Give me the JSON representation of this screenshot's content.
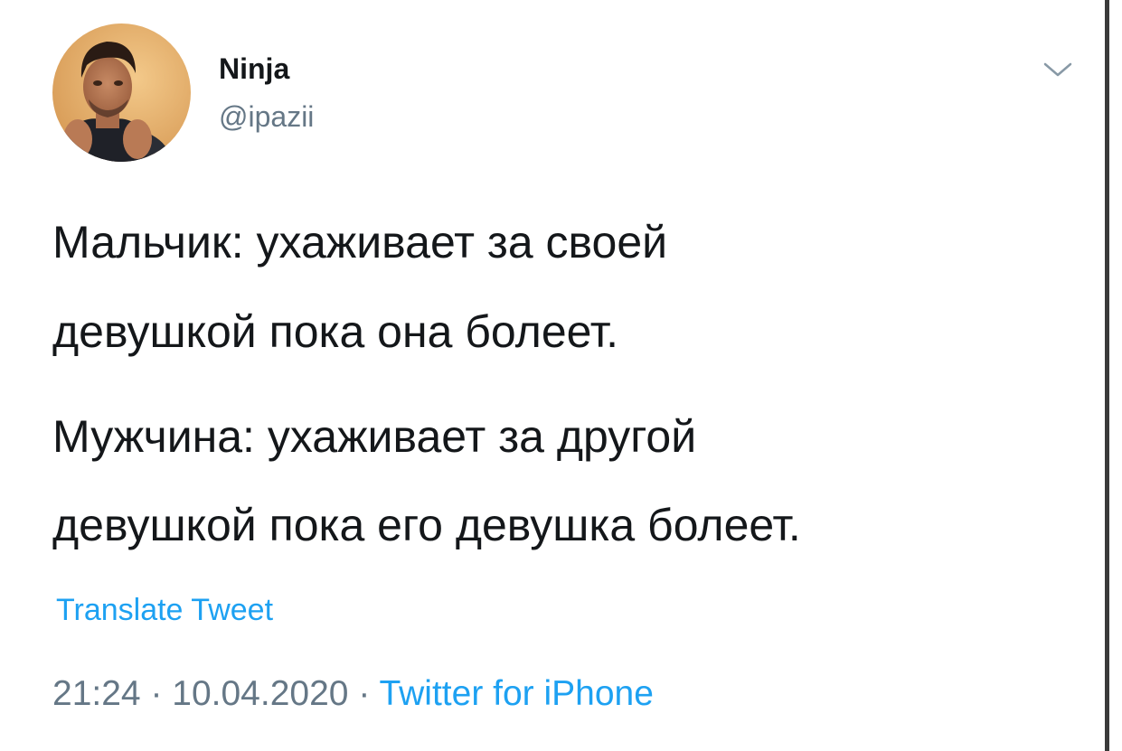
{
  "tweet": {
    "author": {
      "display_name": "Ninja",
      "handle": "@ipazii",
      "avatar_icon": "profile-photo"
    },
    "menu_icon": "chevron-down-icon",
    "text_lines": [
      "Мальчик: ухаживает за своей",
      "девушкой пока она болеет.",
      "Мужчина: ухаживает за другой",
      "девушкой пока его девушка болеет."
    ],
    "translate_label": "Translate Tweet",
    "time": "21:24",
    "date": "10.04.2020",
    "separator": " · ",
    "source": "Twitter for iPhone"
  },
  "colors": {
    "text": "#14171a",
    "secondary": "#657786",
    "link": "#1da1f2",
    "background": "#ffffff",
    "edge": "#3a3a3a"
  }
}
